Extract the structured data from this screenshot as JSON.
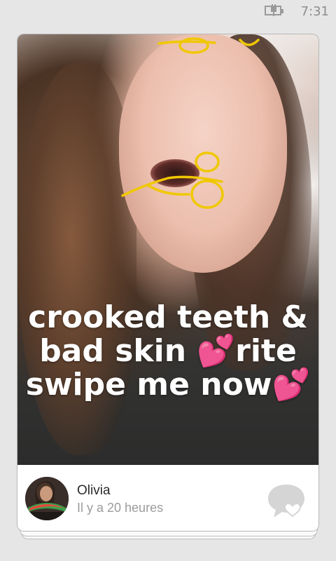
{
  "status_bar": {
    "time": "7:31",
    "battery_icon": "battery-charging-icon"
  },
  "post": {
    "caption_lines": [
      "crooked teeth &",
      "bad skin 💕rite",
      "swipe me now💕"
    ],
    "doodle_color": "#f0c800"
  },
  "author": {
    "name": "Olivia",
    "time_ago": "Il y a 20 heures"
  },
  "actions": {
    "comment_icon": "comment-heart-icon"
  },
  "colors": {
    "background": "#e6e6e6",
    "card": "#ffffff",
    "muted_text": "#9c9c9c",
    "icon_gray": "#d5d5d5"
  }
}
